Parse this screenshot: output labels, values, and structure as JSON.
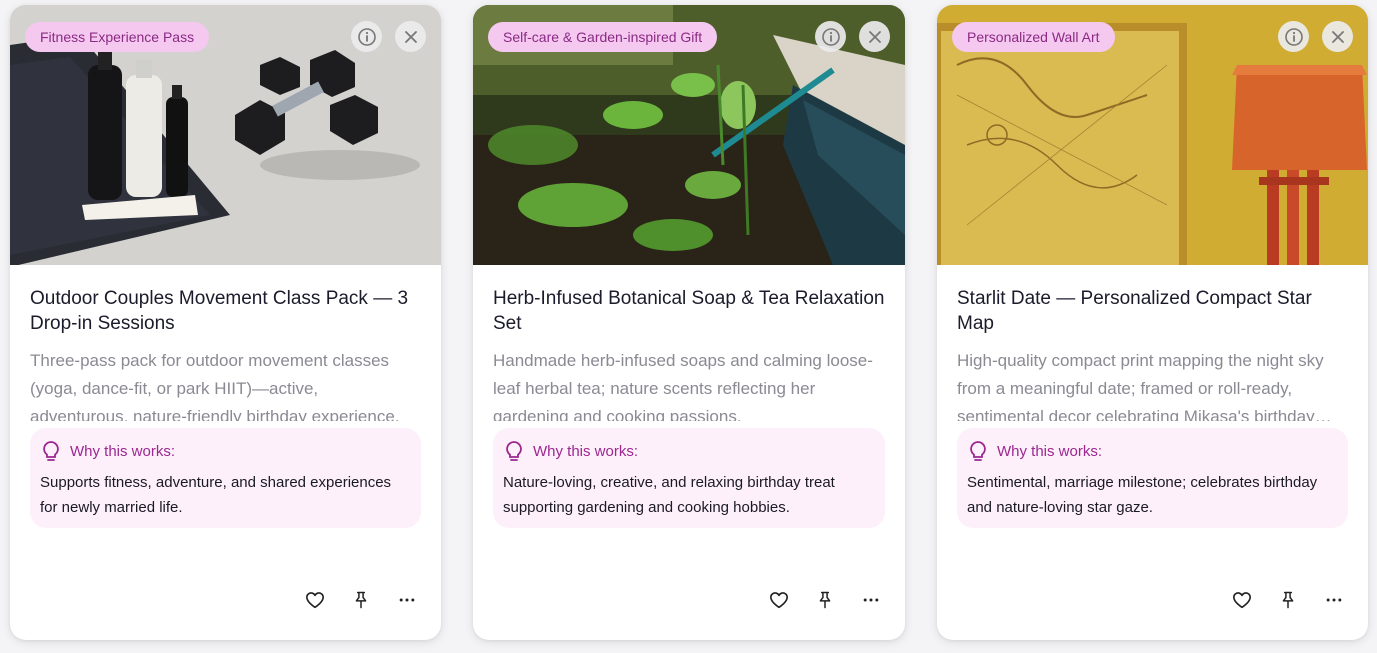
{
  "cards": [
    {
      "tag": "Fitness Experience Pass",
      "title": "Outdoor Couples Movement Class Pack — 3 Drop-in Sessions",
      "description": "Three-pass pack for outdoor movement classes (yoga, dance-fit, or park HIIT)—active, adventurous, nature-friendly birthday experience.",
      "why_label": "Why this works:",
      "why_text": "Supports fitness, adventure, and shared experiences for newly married life.",
      "image": "dumbbells-and-bottles-on-mat"
    },
    {
      "tag": "Self-care & Garden-inspired Gift",
      "title": "Herb-Infused Botanical Soap & Tea Relaxation Set",
      "description": "Handmade herb-infused soaps and calming loose-leaf herbal tea; nature scents reflecting her gardening and cooking passions.",
      "why_label": "Why this works:",
      "why_text": "Nature-loving, creative, and relaxing birthday treat supporting gardening and cooking hobbies.",
      "image": "garden-seedlings"
    },
    {
      "tag": "Personalized Wall Art",
      "title": "Starlit Date — Personalized Compact Star Map",
      "description": "High-quality compact print mapping the night sky from a meaningful date; framed or roll-ready, sentimental decor celebrating Mikasa's birthday…",
      "why_label": "Why this works:",
      "why_text": "Sentimental, marriage milestone; celebrates birthday and nature-loving star gaze.",
      "image": "framed-map-and-lamp"
    }
  ],
  "icons": {
    "info": "info-icon",
    "close": "close-icon",
    "why": "lightbulb-icon",
    "like": "heart-icon",
    "pin": "pin-icon",
    "more": "more-icon"
  },
  "colors": {
    "tag_bg": "#f5c9ef",
    "tag_text": "#8a2a84",
    "why_bg": "#fdf0fb",
    "why_label": "#9b2790"
  }
}
